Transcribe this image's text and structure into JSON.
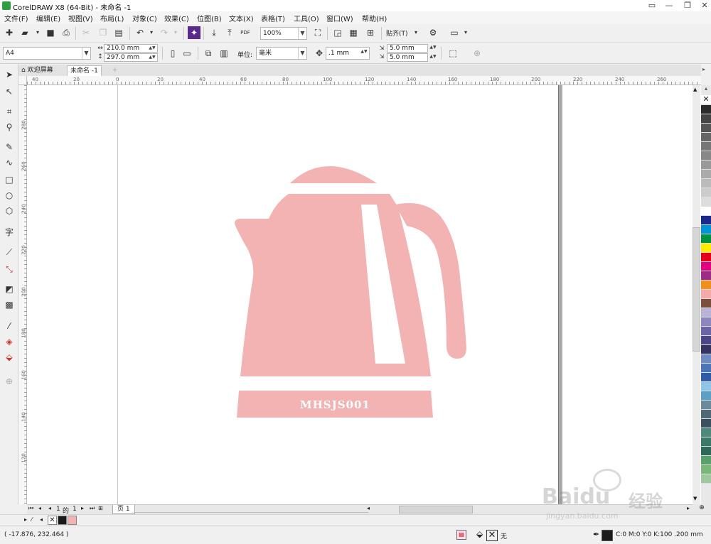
{
  "window": {
    "title": "CorelDRAW X8 (64-Bit) - 未命名 -1",
    "buttons": [
      "▭",
      "—",
      "❐",
      "✕"
    ]
  },
  "menu": [
    "文件(F)",
    "编辑(E)",
    "视图(V)",
    "布局(L)",
    "对象(C)",
    "效果(C)",
    "位图(B)",
    "文本(X)",
    "表格(T)",
    "工具(O)",
    "窗口(W)",
    "帮助(H)"
  ],
  "toolbar": {
    "zoom_value": "100%",
    "snap_label": "贴齐(T)",
    "pdf_label": "PDF"
  },
  "property_bar": {
    "paper_size": "A4",
    "width": "210.0 mm",
    "height": "297.0 mm",
    "units_label": "单位:",
    "units_value": "毫米",
    "nudge": ".1 mm",
    "dup_x": "5.0 mm",
    "dup_y": "5.0 mm"
  },
  "tabs": {
    "welcome": "欢迎屏幕",
    "document": "未命名 -1"
  },
  "ruler": {
    "h_labels": [
      "40",
      "20",
      "0",
      "20",
      "40",
      "60",
      "80",
      "100",
      "120",
      "140",
      "160",
      "180",
      "200",
      "220",
      "240",
      "260"
    ],
    "v_labels": [
      "280",
      "260",
      "240",
      "220",
      "200",
      "180",
      "160",
      "140",
      "120",
      "100",
      "80"
    ],
    "unit": "毫米"
  },
  "artwork": {
    "label": "MHSJS001",
    "color": "#f2b3b2"
  },
  "page_nav": {
    "current": "1",
    "of_label": "的",
    "total": "1",
    "page_tab": "页 1"
  },
  "palette": [
    "#2b2b2b",
    "#444444",
    "#555555",
    "#666666",
    "#777777",
    "#888888",
    "#999999",
    "#aaaaaa",
    "#bbbbbb",
    "#cccccc",
    "#dddddd",
    "#ffffff",
    "#1b2a8a",
    "#0096d6",
    "#00923f",
    "#ffec00",
    "#e3001b",
    "#e4007f",
    "#9c2c85",
    "#f18e1c",
    "#f4aaa8",
    "#7a4e3a",
    "#b8b3d6",
    "#8e86c0",
    "#6b65a8",
    "#4b4784",
    "#363360",
    "#6e8cc3",
    "#4e74b6",
    "#2d5da8",
    "#8dc4e8",
    "#5aa0c8",
    "#6b8a9a",
    "#4e6a77",
    "#3a5260",
    "#4e8a7a",
    "#3b7a6a",
    "#2c6a5a",
    "#5aa06a",
    "#7ab87a",
    "#a0c8a0"
  ],
  "status": {
    "cursor": "( -17.876, 232.464 )",
    "fill_none_label": "无",
    "outline_info": "C:0 M:0 Y:0 K:100 .200 mm"
  },
  "watermark": {
    "text": "Baidu",
    "sub": "经验",
    "url": "jingyan.baidu.com"
  }
}
